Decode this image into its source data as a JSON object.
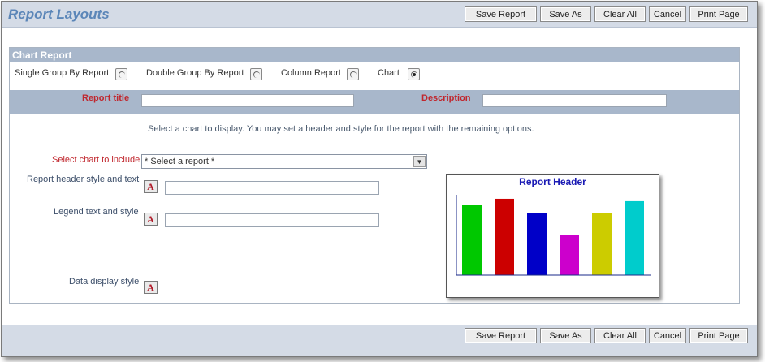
{
  "header": {
    "title": "Report Layouts"
  },
  "toolbar": {
    "save_report": "Save Report",
    "save_as": "Save As",
    "clear_all": "Clear All",
    "cancel": "Cancel",
    "print_page": "Print Page"
  },
  "section": {
    "title": "Chart Report"
  },
  "report_types": [
    {
      "label": "Single Group By Report",
      "checked": false
    },
    {
      "label": "Double Group By Report",
      "checked": false
    },
    {
      "label": "Column Report",
      "checked": false
    },
    {
      "label": "Chart",
      "checked": true
    }
  ],
  "fields": {
    "report_title_label": "Report title",
    "report_title_value": "",
    "description_label": "Description",
    "description_value": ""
  },
  "instructions": "Select a chart to display. You may set a header and style for the report with the remaining options.",
  "chart_select": {
    "label": "Select chart to include",
    "value": "* Select a report *"
  },
  "options": {
    "header_label": "Report header style and text",
    "header_value": "",
    "legend_label": "Legend text and style",
    "legend_value": "",
    "data_display_label": "Data display style"
  },
  "preview": {
    "header": "Report Header"
  },
  "icons": {
    "style_button": "font-style-icon",
    "dropdown": "chevron-down-icon"
  },
  "chart_data": {
    "type": "bar",
    "title": "Report Header",
    "categories": [
      "",
      "",
      "",
      "",
      "",
      ""
    ],
    "values": [
      87,
      95,
      77,
      50,
      77,
      92
    ],
    "colors": [
      "#00c800",
      "#cc0000",
      "#0000c8",
      "#cc00cc",
      "#cccc00",
      "#00cccc"
    ],
    "ylim": [
      0,
      100
    ],
    "grid": false
  }
}
